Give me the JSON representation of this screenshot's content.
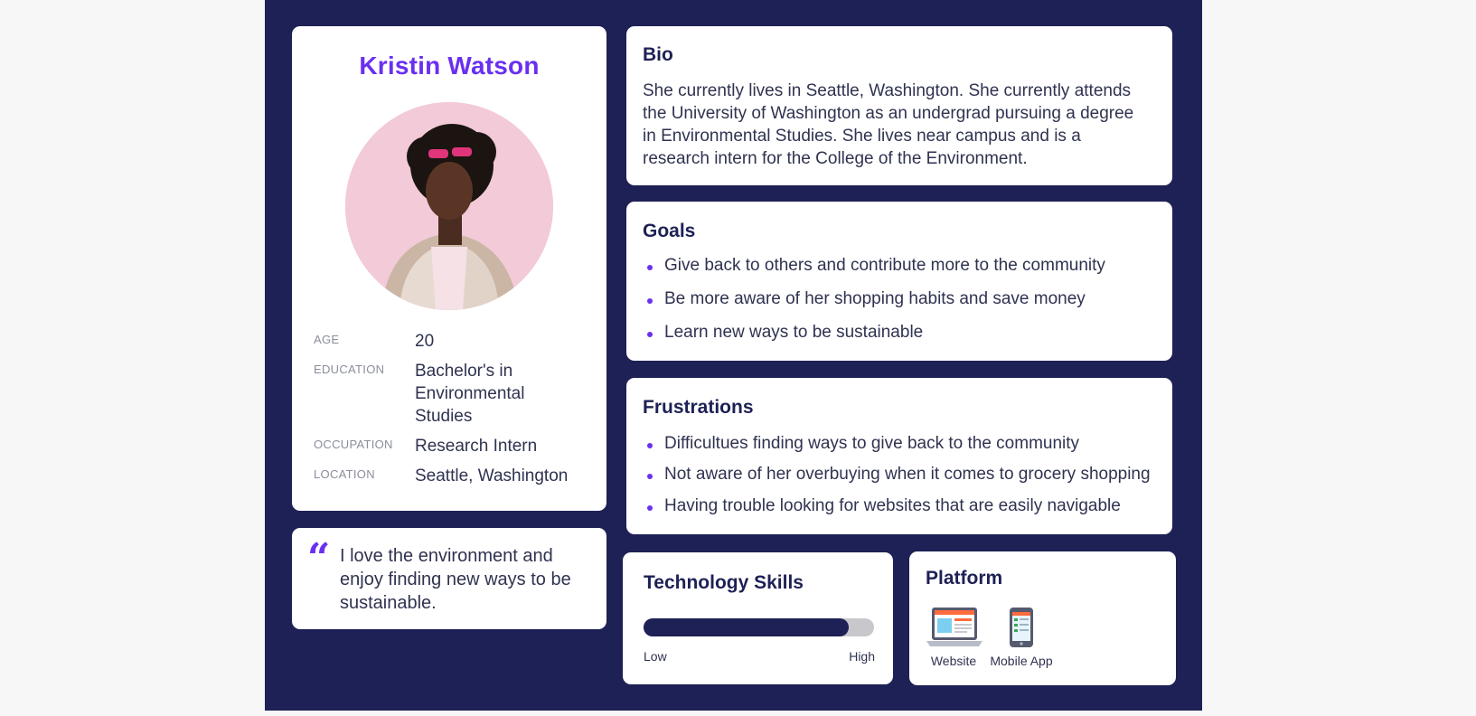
{
  "profile": {
    "name": "Kristin Watson",
    "photo": "portrait-photo",
    "fields": [
      {
        "label": "AGE",
        "value": "20"
      },
      {
        "label": "EDUCATION",
        "value": "Bachelor's in Environmental Studies"
      },
      {
        "label": "OCCUPATION",
        "value": "Research Intern"
      },
      {
        "label": "LOCATION",
        "value": "Seattle, Washington"
      }
    ]
  },
  "quote": {
    "icon": "quote-icon",
    "text": "I love the environment and enjoy finding new ways to be sustainable."
  },
  "bio": {
    "title": "Bio",
    "text": "She currently lives in Seattle, Washington. She currently attends the University of Washington as an undergrad pursuing a degree in Environmental Studies. She lives near campus and is a research intern for the College of the Environment."
  },
  "goals": {
    "title": "Goals",
    "items": [
      "Give back to others and contribute more to the community",
      "Be more aware of her shopping habits and save money",
      "Learn new ways to be sustainable"
    ]
  },
  "frustrations": {
    "title": "Frustrations",
    "items": [
      "Difficultues finding ways to give back to the community",
      "Not aware of her overbuying when it comes to grocery shopping",
      "Having trouble looking for websites that are easily navigable"
    ]
  },
  "tech_skills": {
    "title": "Technology Skills",
    "level_fraction": 0.89,
    "low_label": "Low",
    "high_label": "High"
  },
  "platform": {
    "title": "Platform",
    "items": [
      {
        "label": "Website",
        "icon": "laptop-icon"
      },
      {
        "label": "Mobile App",
        "icon": "phone-icon"
      }
    ]
  },
  "colors": {
    "board_bg": "#1e2155",
    "accent": "#6a30f0",
    "card_bg": "#ffffff",
    "bar_fill": "#1e2155",
    "bar_track": "#c8c8cc"
  }
}
